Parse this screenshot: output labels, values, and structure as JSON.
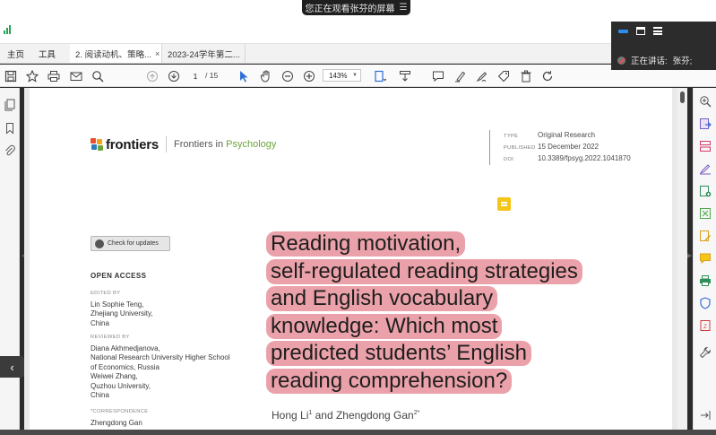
{
  "share_banner": {
    "text": "您正在观看张芬的屏幕",
    "icon": "menu-icon"
  },
  "speaking_panel": {
    "label": "正在讲话:",
    "speaker": "张芬;"
  },
  "tabs": {
    "home": "主页",
    "tools": "工具",
    "documents": [
      {
        "title": "2. 阅读动机、策略...",
        "close": "×",
        "active": true
      },
      {
        "title": "2023-24学年第二...",
        "close": "",
        "active": false
      }
    ]
  },
  "toolbar": {
    "page_current": "1",
    "page_total": "/ 15",
    "zoom": "143%"
  },
  "paper": {
    "logo_word": "frontiers",
    "journal_prefix": "Frontiers in ",
    "journal_subject": "Psychology",
    "meta": [
      {
        "key": "TYPE",
        "value": "Original Research"
      },
      {
        "key": "PUBLISHED",
        "value": "15 December 2022"
      },
      {
        "key": "DOI",
        "value": "10.3389/fpsyg.2022.1041870"
      }
    ],
    "check_updates": "Check for updates",
    "open_access": "OPEN ACCESS",
    "edited_by_label": "EDITED BY",
    "edited_by": [
      "Lin Sophie Teng,",
      "Zhejiang University,",
      "China"
    ],
    "reviewed_by_label": "REVIEWED BY",
    "reviewed_by": [
      "Diana Akhmedjanova,",
      "National Research University Higher School",
      "of Economics, Russia",
      "Weiwei Zhang,",
      "Quzhou University,",
      "China"
    ],
    "correspondence_label": "*CORRESPONDENCE",
    "correspondence": "Zhengdong Gan",
    "title_lines": [
      "Reading motivation,",
      "self-regulated reading strategies",
      "and English vocabulary",
      "knowledge: Which most",
      "predicted students’ English",
      "reading comprehension?"
    ],
    "author1": "Hong Li",
    "author1_sup": "1",
    "author_and": " and Zhengdong Gan",
    "author2_sup": "2*"
  },
  "colors": {
    "highlight": "#eba1a9",
    "psychology_green": "#6ba43a",
    "note_yellow": "#f5c518",
    "signal_green": "#23a455"
  }
}
